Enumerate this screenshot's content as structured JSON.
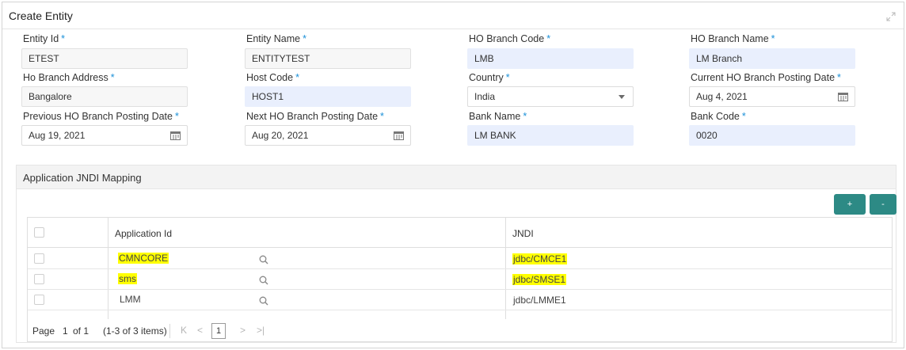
{
  "window": {
    "title": "Create Entity"
  },
  "form": {
    "entity_id": {
      "label": "Entity Id",
      "value": "ETEST"
    },
    "entity_name": {
      "label": "Entity Name",
      "value": "ENTITYTEST"
    },
    "ho_branch_code": {
      "label": "HO Branch Code",
      "value": "LMB"
    },
    "ho_branch_name": {
      "label": "HO Branch Name",
      "value": "LM Branch"
    },
    "ho_branch_address": {
      "label": "Ho Branch Address",
      "value": "Bangalore"
    },
    "host_code": {
      "label": "Host Code",
      "value": "HOST1"
    },
    "country": {
      "label": "Country",
      "value": "India"
    },
    "current_ho_posting_date": {
      "label": "Current HO Branch Posting Date",
      "value": "Aug 4, 2021"
    },
    "previous_ho_posting_date": {
      "label": "Previous HO Branch Posting Date",
      "value": "Aug 19, 2021"
    },
    "next_ho_posting_date": {
      "label": "Next HO Branch Posting Date",
      "value": "Aug 20, 2021"
    },
    "bank_name": {
      "label": "Bank Name",
      "value": "LM BANK"
    },
    "bank_code": {
      "label": "Bank Code",
      "value": "0020"
    },
    "required_mark": "*"
  },
  "mapping": {
    "title": "Application JNDI Mapping",
    "add_label": "+",
    "remove_label": "-",
    "columns": [
      "Application Id",
      "JNDI"
    ],
    "rows": [
      {
        "app_id": "CMNCORE",
        "jndi": "jdbc/CMCE1"
      },
      {
        "app_id": "sms",
        "jndi": "jdbc/SMSE1"
      },
      {
        "app_id": "LMM",
        "jndi": "jdbc/LMME1"
      }
    ],
    "pager": {
      "page_label": "Page",
      "page_number": "1",
      "of_text": "of 1",
      "items_text": "(1-3 of 3 items)",
      "current_page": "1"
    }
  },
  "colors": {
    "accent_button": "#2d8a85",
    "required_star": "#1b90d8",
    "highlight": "#ffff00",
    "mandatory_field": "#e9effd"
  }
}
